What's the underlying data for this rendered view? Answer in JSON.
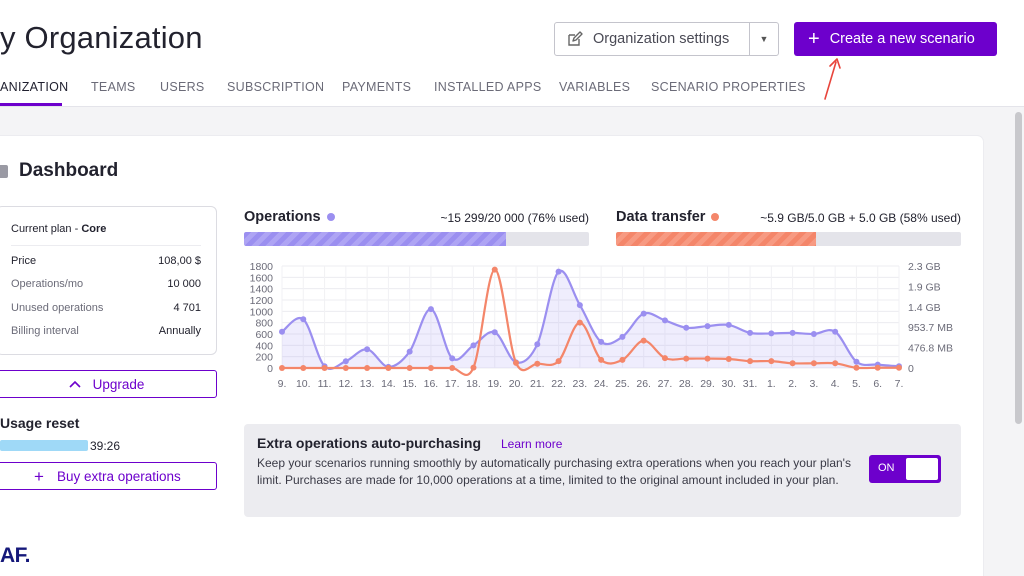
{
  "header": {
    "title": "y Organization",
    "org_settings_label": "Organization settings",
    "create_label": "Create a new scenario"
  },
  "tabs": [
    {
      "label": "ANIZATION",
      "active": true
    },
    {
      "label": "TEAMS"
    },
    {
      "label": "USERS"
    },
    {
      "label": "SUBSCRIPTION"
    },
    {
      "label": "PAYMENTS"
    },
    {
      "label": "INSTALLED APPS"
    },
    {
      "label": "VARIABLES"
    },
    {
      "label": "SCENARIO PROPERTIES"
    }
  ],
  "dashboard": {
    "title": "Dashboard",
    "plan": {
      "header_prefix": "Current plan - ",
      "header_plan": "Core",
      "rows": [
        {
          "key": "Price",
          "value": "108,00 $"
        },
        {
          "key": "Operations/mo",
          "value": "10 000"
        },
        {
          "key": "Unused operations",
          "value": "4 701"
        },
        {
          "key": "Billing interval",
          "value": "Annually"
        }
      ]
    },
    "upgrade_label": "Upgrade",
    "usage_reset": {
      "title": "Usage reset",
      "time": "39:26"
    },
    "buy_label": "Buy extra operations"
  },
  "metrics": {
    "operations": {
      "title": "Operations",
      "usage": "~15 299/20 000 (76% used)",
      "fraction": 0.76,
      "color": "#9b8ff0"
    },
    "data_transfer": {
      "title": "Data transfer",
      "usage": "~5.9 GB/5.0 GB + 5.0 GB (58% used)",
      "fraction": 0.58,
      "color": "#f4866a"
    }
  },
  "chart_data": {
    "type": "line",
    "categories": [
      "9.",
      "10.",
      "11.",
      "12.",
      "13.",
      "14.",
      "15.",
      "16.",
      "17.",
      "18.",
      "19.",
      "20.",
      "21.",
      "22.",
      "23.",
      "24.",
      "25.",
      "26.",
      "27.",
      "28.",
      "29.",
      "30.",
      "31.",
      "1.",
      "2.",
      "3.",
      "4.",
      "5.",
      "6.",
      "7."
    ],
    "y_left_ticks": [
      "1800",
      "1600",
      "1400",
      "1200",
      "1000",
      "800",
      "600",
      "400",
      "200",
      "0"
    ],
    "y_right_ticks": [
      "2.3 GB",
      "1.9 GB",
      "1.4 GB",
      "953.7 MB",
      "476.8 MB",
      "0"
    ],
    "ylim_left": [
      0,
      1800
    ],
    "ylim_right_mb": [
      0,
      2384
    ],
    "grid": true,
    "series": [
      {
        "name": "Operations",
        "axis": "left",
        "color": "#9b8ff0",
        "values": [
          640,
          860,
          30,
          120,
          330,
          20,
          290,
          1040,
          170,
          400,
          630,
          100,
          420,
          1700,
          1110,
          460,
          550,
          960,
          840,
          710,
          740,
          760,
          620,
          610,
          620,
          600,
          640,
          110,
          60,
          30
        ]
      },
      {
        "name": "Data transfer",
        "axis": "right",
        "unit": "MB",
        "color": "#f4866a",
        "values": [
          0,
          0,
          0,
          0,
          0,
          0,
          0,
          0,
          0,
          10,
          2300,
          120,
          100,
          160,
          1060,
          190,
          190,
          640,
          230,
          220,
          220,
          210,
          160,
          160,
          110,
          110,
          110,
          5,
          5,
          5
        ]
      }
    ]
  },
  "auto_purchase": {
    "title": "Extra operations auto-purchasing",
    "learn_more": "Learn more",
    "description": "Keep your scenarios running smoothly by automatically purchasing extra operations when you reach your plan's limit. Purchases are made for 10,000 operations at a time, limited to the original amount included in your plan.",
    "toggle_label": "ON"
  },
  "logo_text": "AF."
}
